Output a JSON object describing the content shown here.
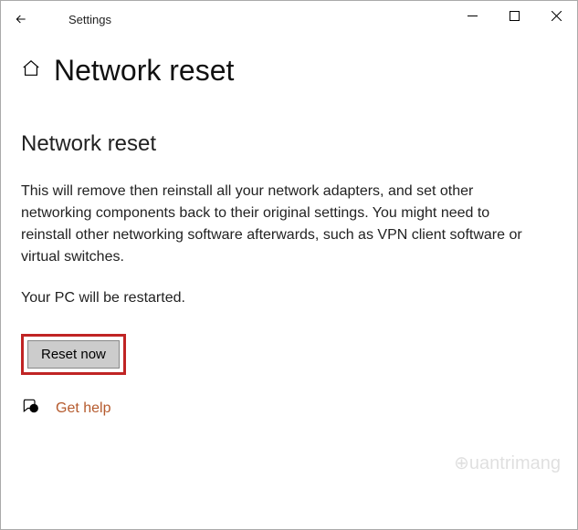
{
  "titlebar": {
    "app_name": "Settings"
  },
  "header": {
    "page_title": "Network reset"
  },
  "content": {
    "section_title": "Network reset",
    "description": "This will remove then reinstall all your network adapters, and set other networking components back to their original settings. You might need to reinstall other networking software afterwards, such as VPN client software or virtual switches.",
    "restart_note": "Your PC will be restarted.",
    "reset_button_label": "Reset now",
    "help_link_label": "Get help"
  }
}
